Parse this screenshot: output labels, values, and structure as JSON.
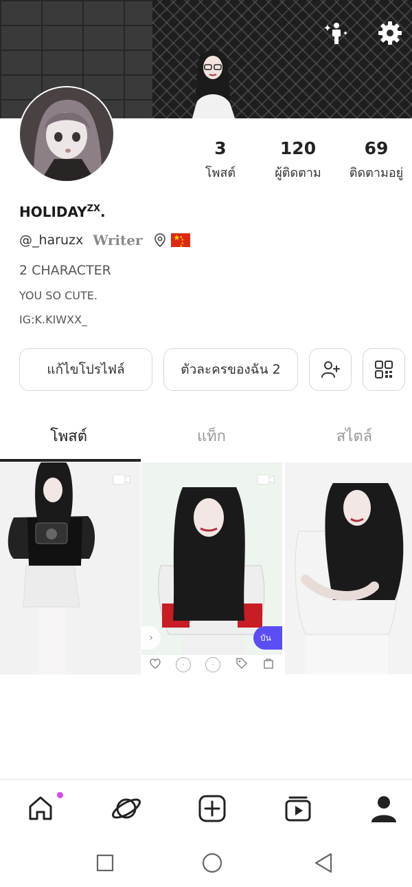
{
  "profile": {
    "name": "HOLIDAY",
    "name_sup": "ZX",
    "name_suffix": ".",
    "handle": "@_haruzx",
    "role": "Writer",
    "bio": [
      "2 CHARACTER",
      "YOU SO CUTE.",
      "IG:K.KIWXX_"
    ]
  },
  "stats": [
    {
      "value": "3",
      "label": "โพสต์"
    },
    {
      "value": "120",
      "label": "ผู้ติดตาม"
    },
    {
      "value": "69",
      "label": "ติดตามอยู่"
    }
  ],
  "actions": {
    "edit_profile": "แก้ไขโปรไฟล์",
    "my_characters": "ตัวละครของฉัน 2"
  },
  "tabs": [
    {
      "label": "โพสต์",
      "active": true
    },
    {
      "label": "แท็ก",
      "active": false
    },
    {
      "label": "สไตล์",
      "active": false
    }
  ],
  "post_overlay": {
    "pill_text": "บัน"
  },
  "colors": {
    "accent": "#5a4df5",
    "notification_dot": "#d946ef",
    "flag_red": "#de2910",
    "flag_yellow": "#ffde00"
  },
  "icons": {
    "cover": [
      "sparkle-person-icon",
      "gear-icon"
    ],
    "bottom_nav": [
      "home-icon",
      "planet-icon",
      "add-post-icon",
      "video-feed-icon",
      "profile-icon"
    ],
    "system_nav": [
      "recents-icon",
      "home-circle-icon",
      "back-icon"
    ]
  }
}
